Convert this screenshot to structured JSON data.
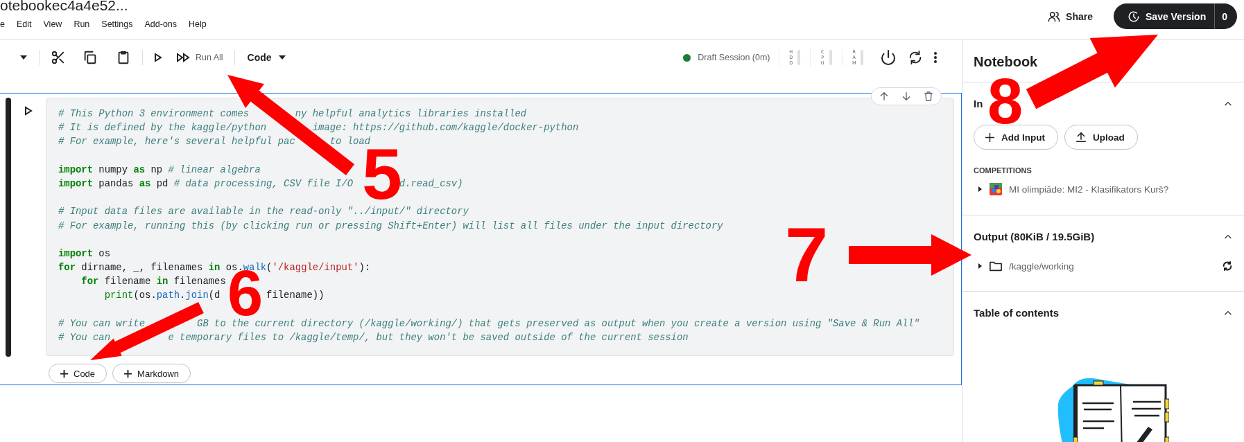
{
  "title": "otebookec4a4e52...",
  "menu": [
    "e",
    "Edit",
    "View",
    "Run",
    "Settings",
    "Add-ons",
    "Help"
  ],
  "header_actions": {
    "share": "Share",
    "save_version": "Save Version",
    "version_count": "0"
  },
  "toolbar": {
    "run_all": "Run All",
    "cell_type": "Code",
    "session": {
      "status": "Draft Session (0m)",
      "color": "#1e7b34"
    },
    "meters": [
      {
        "label": "HDD",
        "level": 0
      },
      {
        "label": "CPU",
        "level": 0
      },
      {
        "label": "RAM",
        "level": 0
      }
    ]
  },
  "cell": {
    "lines": [
      {
        "kind": "code",
        "tokens": [
          {
            "kind": "comment",
            "s": "# This Python 3 environment comes        ny helpful analytics libraries installed"
          }
        ]
      },
      {
        "kind": "code",
        "tokens": [
          {
            "kind": "comment",
            "s": "# It is defined by the kaggle/python        image: https://github.com/kaggle/docker-python"
          }
        ]
      },
      {
        "kind": "code",
        "tokens": [
          {
            "kind": "comment",
            "s": "# For example, here's several helpful pac      to load"
          }
        ]
      },
      {
        "kind": "blank"
      },
      {
        "kind": "code",
        "tokens": [
          {
            "kind": "kw",
            "s": "import"
          },
          {
            "kind": "plain",
            "s": " numpy "
          },
          {
            "kind": "kw",
            "s": "as"
          },
          {
            "kind": "plain",
            "s": " np "
          },
          {
            "kind": "comment",
            "s": "# linear algebra"
          }
        ]
      },
      {
        "kind": "code",
        "tokens": [
          {
            "kind": "kw",
            "s": "import"
          },
          {
            "kind": "plain",
            "s": " pandas "
          },
          {
            "kind": "kw",
            "s": "as"
          },
          {
            "kind": "plain",
            "s": " pd "
          },
          {
            "kind": "comment",
            "s": "# data processing, CSV file I/O        d.read_csv)"
          }
        ]
      },
      {
        "kind": "blank"
      },
      {
        "kind": "code",
        "tokens": [
          {
            "kind": "comment",
            "s": "# Input data files are available in the read-only \"../input/\" directory"
          }
        ]
      },
      {
        "kind": "code",
        "tokens": [
          {
            "kind": "comment",
            "s": "# For example, running this (by clicking run or pressing Shift+Enter) will list all files under the input directory"
          }
        ]
      },
      {
        "kind": "blank"
      },
      {
        "kind": "code",
        "tokens": [
          {
            "kind": "kw",
            "s": "import"
          },
          {
            "kind": "plain",
            "s": " os"
          }
        ]
      },
      {
        "kind": "code",
        "tokens": [
          {
            "kind": "kw",
            "s": "for"
          },
          {
            "kind": "plain",
            "s": " dirname, _, filenames "
          },
          {
            "kind": "kw",
            "s": "in"
          },
          {
            "kind": "plain",
            "s": " os."
          },
          {
            "kind": "attr",
            "s": "walk"
          },
          {
            "kind": "plain",
            "s": "("
          },
          {
            "kind": "str",
            "s": "'/kaggle/input'"
          },
          {
            "kind": "plain",
            "s": "):"
          }
        ]
      },
      {
        "kind": "code",
        "tokens": [
          {
            "kind": "kw",
            "s": "    for"
          },
          {
            "kind": "plain",
            "s": " filename "
          },
          {
            "kind": "kw",
            "s": "in"
          },
          {
            "kind": "plain",
            "s": " filenames"
          }
        ]
      },
      {
        "kind": "code",
        "tokens": [
          {
            "kind": "builtin",
            "s": "        print"
          },
          {
            "kind": "plain",
            "s": "(os."
          },
          {
            "kind": "attr",
            "s": "path"
          },
          {
            "kind": "plain",
            "s": "."
          },
          {
            "kind": "attr",
            "s": "join"
          },
          {
            "kind": "plain",
            "s": "(d        filename))"
          }
        ]
      },
      {
        "kind": "blank"
      },
      {
        "kind": "code",
        "tokens": [
          {
            "kind": "comment",
            "s": "# You can write         GB to the current directory (/kaggle/working/) that gets preserved as output when you create a version using \"Save & Run All\""
          }
        ]
      },
      {
        "kind": "code",
        "tokens": [
          {
            "kind": "comment",
            "s": "# You can          e temporary files to /kaggle/temp/, but they won't be saved outside of the current session"
          }
        ]
      }
    ]
  },
  "add_cell_buttons": [
    "Code",
    "Markdown"
  ],
  "sidebar": {
    "title": "Notebook",
    "sections": [
      {
        "title": "In",
        "expanded": true,
        "buttons": [
          {
            "kind": "add",
            "label": "Add Input"
          },
          {
            "kind": "upload",
            "label": "Upload"
          }
        ],
        "group": "COMPETITIONS",
        "items": [
          {
            "kind": "competition",
            "label": "MI olimpiāde: MI2 - Klasifikators Kurš?",
            "expanded": false
          }
        ]
      },
      {
        "title": "Output (80KiB / 19.5GiB)",
        "expanded": true,
        "items": [
          {
            "kind": "folder",
            "label": "/kaggle/working",
            "expanded": false
          }
        ]
      },
      {
        "title": "Table of contents",
        "expanded": true
      }
    ]
  },
  "annotations": [
    {
      "label": "5"
    },
    {
      "label": "6"
    },
    {
      "label": "7"
    },
    {
      "label": "8"
    }
  ]
}
